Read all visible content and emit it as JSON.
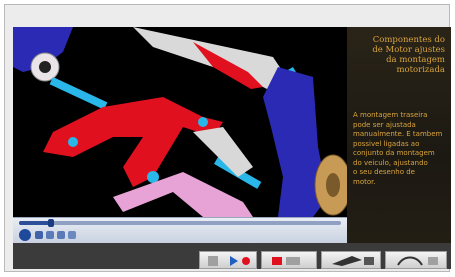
{
  "info_panel": {
    "title": "Componentes do\nde Motor ajustes\nda montagem\nmotorizada",
    "body": "A montagem traseira\npode ser ajustada\nmanualmente. E tambem\npossivel ligadas ao\nconjunto da montagem\ndo veiculo, ajustando\no seu desenho de\nmotor."
  },
  "player": {
    "progress": 0.1
  },
  "colors": {
    "panel_text": "#d9a43c",
    "arm_red": "#e0101e",
    "knuckle_blue": "#2a2ab4",
    "accent_cyan": "#29b6e8"
  },
  "icons": {
    "play": "play-icon",
    "nav_buttons": [
      "previous-icon",
      "part-view-icon",
      "tool-icon",
      "next-icon"
    ]
  }
}
